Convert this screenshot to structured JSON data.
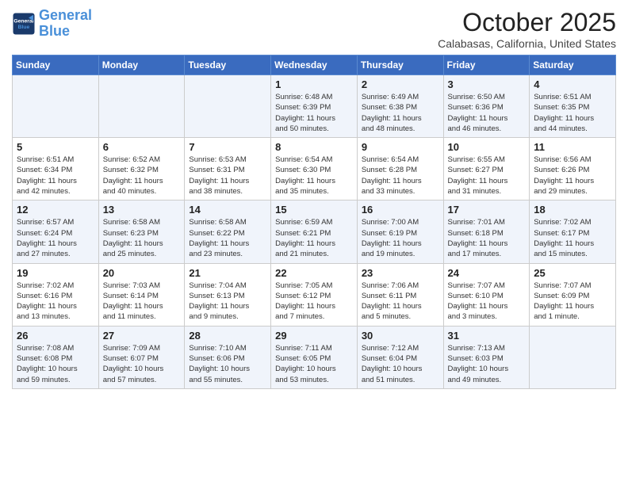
{
  "logo": {
    "line1": "General",
    "line2": "Blue"
  },
  "header": {
    "month": "October 2025",
    "location": "Calabasas, California, United States"
  },
  "weekdays": [
    "Sunday",
    "Monday",
    "Tuesday",
    "Wednesday",
    "Thursday",
    "Friday",
    "Saturday"
  ],
  "weeks": [
    [
      {
        "day": "",
        "info": ""
      },
      {
        "day": "",
        "info": ""
      },
      {
        "day": "",
        "info": ""
      },
      {
        "day": "1",
        "info": "Sunrise: 6:48 AM\nSunset: 6:39 PM\nDaylight: 11 hours\nand 50 minutes."
      },
      {
        "day": "2",
        "info": "Sunrise: 6:49 AM\nSunset: 6:38 PM\nDaylight: 11 hours\nand 48 minutes."
      },
      {
        "day": "3",
        "info": "Sunrise: 6:50 AM\nSunset: 6:36 PM\nDaylight: 11 hours\nand 46 minutes."
      },
      {
        "day": "4",
        "info": "Sunrise: 6:51 AM\nSunset: 6:35 PM\nDaylight: 11 hours\nand 44 minutes."
      }
    ],
    [
      {
        "day": "5",
        "info": "Sunrise: 6:51 AM\nSunset: 6:34 PM\nDaylight: 11 hours\nand 42 minutes."
      },
      {
        "day": "6",
        "info": "Sunrise: 6:52 AM\nSunset: 6:32 PM\nDaylight: 11 hours\nand 40 minutes."
      },
      {
        "day": "7",
        "info": "Sunrise: 6:53 AM\nSunset: 6:31 PM\nDaylight: 11 hours\nand 38 minutes."
      },
      {
        "day": "8",
        "info": "Sunrise: 6:54 AM\nSunset: 6:30 PM\nDaylight: 11 hours\nand 35 minutes."
      },
      {
        "day": "9",
        "info": "Sunrise: 6:54 AM\nSunset: 6:28 PM\nDaylight: 11 hours\nand 33 minutes."
      },
      {
        "day": "10",
        "info": "Sunrise: 6:55 AM\nSunset: 6:27 PM\nDaylight: 11 hours\nand 31 minutes."
      },
      {
        "day": "11",
        "info": "Sunrise: 6:56 AM\nSunset: 6:26 PM\nDaylight: 11 hours\nand 29 minutes."
      }
    ],
    [
      {
        "day": "12",
        "info": "Sunrise: 6:57 AM\nSunset: 6:24 PM\nDaylight: 11 hours\nand 27 minutes."
      },
      {
        "day": "13",
        "info": "Sunrise: 6:58 AM\nSunset: 6:23 PM\nDaylight: 11 hours\nand 25 minutes."
      },
      {
        "day": "14",
        "info": "Sunrise: 6:58 AM\nSunset: 6:22 PM\nDaylight: 11 hours\nand 23 minutes."
      },
      {
        "day": "15",
        "info": "Sunrise: 6:59 AM\nSunset: 6:21 PM\nDaylight: 11 hours\nand 21 minutes."
      },
      {
        "day": "16",
        "info": "Sunrise: 7:00 AM\nSunset: 6:19 PM\nDaylight: 11 hours\nand 19 minutes."
      },
      {
        "day": "17",
        "info": "Sunrise: 7:01 AM\nSunset: 6:18 PM\nDaylight: 11 hours\nand 17 minutes."
      },
      {
        "day": "18",
        "info": "Sunrise: 7:02 AM\nSunset: 6:17 PM\nDaylight: 11 hours\nand 15 minutes."
      }
    ],
    [
      {
        "day": "19",
        "info": "Sunrise: 7:02 AM\nSunset: 6:16 PM\nDaylight: 11 hours\nand 13 minutes."
      },
      {
        "day": "20",
        "info": "Sunrise: 7:03 AM\nSunset: 6:14 PM\nDaylight: 11 hours\nand 11 minutes."
      },
      {
        "day": "21",
        "info": "Sunrise: 7:04 AM\nSunset: 6:13 PM\nDaylight: 11 hours\nand 9 minutes."
      },
      {
        "day": "22",
        "info": "Sunrise: 7:05 AM\nSunset: 6:12 PM\nDaylight: 11 hours\nand 7 minutes."
      },
      {
        "day": "23",
        "info": "Sunrise: 7:06 AM\nSunset: 6:11 PM\nDaylight: 11 hours\nand 5 minutes."
      },
      {
        "day": "24",
        "info": "Sunrise: 7:07 AM\nSunset: 6:10 PM\nDaylight: 11 hours\nand 3 minutes."
      },
      {
        "day": "25",
        "info": "Sunrise: 7:07 AM\nSunset: 6:09 PM\nDaylight: 11 hours\nand 1 minute."
      }
    ],
    [
      {
        "day": "26",
        "info": "Sunrise: 7:08 AM\nSunset: 6:08 PM\nDaylight: 10 hours\nand 59 minutes."
      },
      {
        "day": "27",
        "info": "Sunrise: 7:09 AM\nSunset: 6:07 PM\nDaylight: 10 hours\nand 57 minutes."
      },
      {
        "day": "28",
        "info": "Sunrise: 7:10 AM\nSunset: 6:06 PM\nDaylight: 10 hours\nand 55 minutes."
      },
      {
        "day": "29",
        "info": "Sunrise: 7:11 AM\nSunset: 6:05 PM\nDaylight: 10 hours\nand 53 minutes."
      },
      {
        "day": "30",
        "info": "Sunrise: 7:12 AM\nSunset: 6:04 PM\nDaylight: 10 hours\nand 51 minutes."
      },
      {
        "day": "31",
        "info": "Sunrise: 7:13 AM\nSunset: 6:03 PM\nDaylight: 10 hours\nand 49 minutes."
      },
      {
        "day": "",
        "info": ""
      }
    ]
  ]
}
